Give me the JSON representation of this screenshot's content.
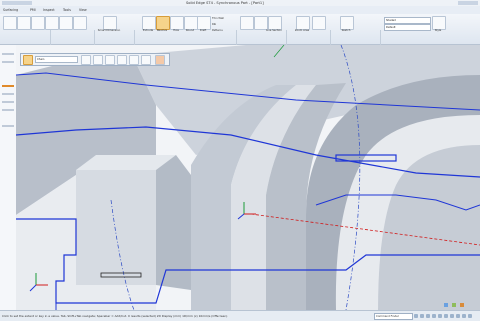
{
  "app": {
    "title": "Solid Edge ST4 - Synchronous Part - [Part1]"
  },
  "menu_tabs": [
    "Surfacing",
    "PMI",
    "Inspect",
    "Tools",
    "View"
  ],
  "ribbon": {
    "buttons": [
      {
        "name": "smart-dimension",
        "label": "Smart Dimension"
      },
      {
        "name": "extrude",
        "label": "Extrude"
      },
      {
        "name": "revolve",
        "label": "Revolve",
        "active": true
      },
      {
        "name": "hole",
        "label": "Hole"
      },
      {
        "name": "round",
        "label": "Round"
      },
      {
        "name": "draft",
        "label": "Draft"
      },
      {
        "name": "live-section",
        "label": "Live Section"
      },
      {
        "name": "zoom-area",
        "label": "Zoom Area"
      },
      {
        "name": "sketch",
        "label": "Sketch"
      },
      {
        "name": "style",
        "label": "Style"
      }
    ],
    "small_items": [
      "Thin Wall",
      "Rib",
      "Patterns"
    ],
    "groups": [
      "Draw",
      "Relate",
      "Dimension",
      "Solids",
      "Face Relate",
      "Planes",
      "Select",
      "Section",
      "Style"
    ],
    "style_combo": "Shaded",
    "style_combo2": "Default"
  },
  "quickbar": {
    "combo_value": "Chain"
  },
  "status": {
    "text": "Click to set the extent or key in a value. Tab, Shift+Tab navigate; Spacebar = Add/Cut.  0 results (selected) 2D Display (mm) 1D/mm (x) 10mm/s (Offscreen)",
    "command_label": "Command Finder"
  },
  "colors": {
    "model_face": "#c5ccd6",
    "sketch_blue": "#1f36d6",
    "axis_red": "#d11b1b",
    "accent_active": "#f6d38a"
  }
}
